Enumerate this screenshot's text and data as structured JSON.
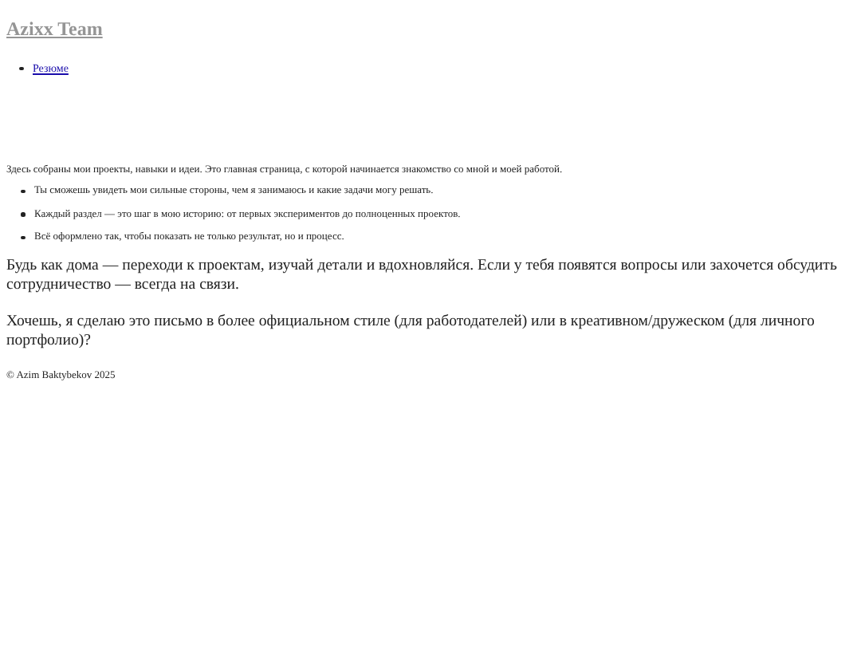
{
  "site_title": "Azixx Team",
  "nav": [
    {
      "label": "Резюме"
    }
  ],
  "intro": "Здесь собраны мои проекты, навыки и идеи. Это главная страница, с которой начинается знакомство со мной и моей работой.",
  "points": [
    "Ты сможешь увидеть мои сильные стороны, чем я занимаюсь и какие задачи могу решать.",
    "Каждый раздел — это шаг в мою историю: от первых экспериментов до полноценных проектов.",
    "Всё оформлено так, чтобы показать не только результат, но и процесс."
  ],
  "paragraphs": [
    "Будь как дома — переходи к проектам, изучай детали и вдохновляйся. Если у тебя появятся вопросы или захочется обсудить сотрудничество — всегда на связи.",
    "Хочешь, я сделаю это письмо в более официальном стиле (для работодателей) или в креативном/дружеском (для личного портфолио)?"
  ],
  "footer": "© Azim Baktybekov 2025"
}
